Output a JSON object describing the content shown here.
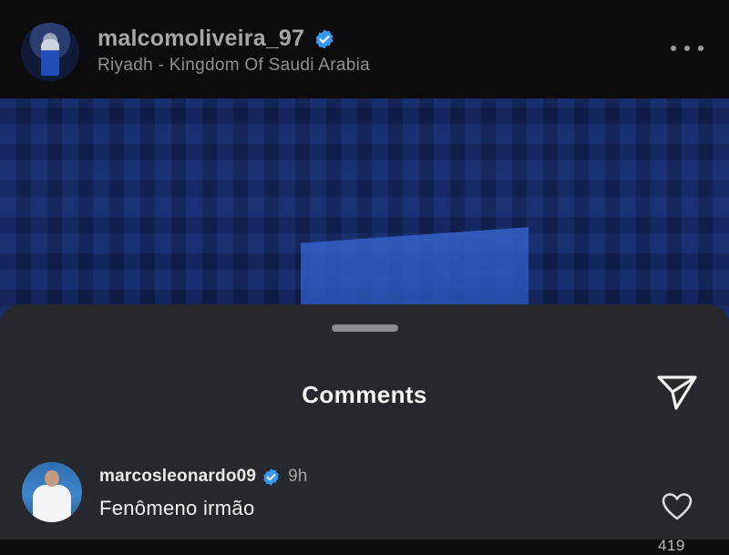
{
  "post": {
    "username": "malcomoliveira_97",
    "location": "Riyadh - Kingdom Of Saudi Arabia",
    "verified": true
  },
  "comments_sheet": {
    "title": "Comments",
    "items": [
      {
        "username": "marcosleonardo09",
        "verified": true,
        "time": "9h",
        "text": "Fenômeno irmão",
        "likes": "419"
      }
    ]
  },
  "icons": {
    "verified": "verified-badge-icon",
    "more": "more-horizontal-icon",
    "share": "paper-plane-icon",
    "like": "heart-outline-icon"
  },
  "colors": {
    "background": "#0c0c0e",
    "sheet": "#26282d",
    "verified_blue": "#3897f0"
  }
}
